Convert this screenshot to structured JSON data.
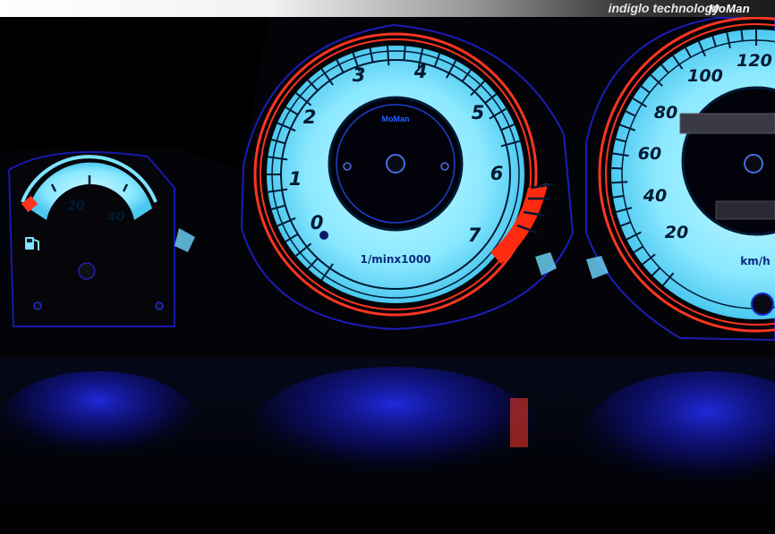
{
  "banner": {
    "tagline": "indiglo technology",
    "brand": "MoMan"
  },
  "colors": {
    "dial_face": "#7de3ff",
    "dial_glow": "#b8f4ff",
    "red_ring": "#ff3520",
    "redline": "#ff2a10",
    "background": "#000000",
    "reflection": "#1a22ff"
  },
  "fuel_gauge": {
    "icon": "fuel-pump-icon",
    "labels": [
      "20",
      "40"
    ]
  },
  "tachometer": {
    "brand": "MoMan",
    "labels": [
      "0",
      "1",
      "2",
      "3",
      "4",
      "5",
      "6",
      "7"
    ],
    "unit": "1/minx1000"
  },
  "speedometer": {
    "labels": [
      "20",
      "40",
      "60",
      "80",
      "100",
      "120"
    ],
    "unit": "km/h"
  }
}
